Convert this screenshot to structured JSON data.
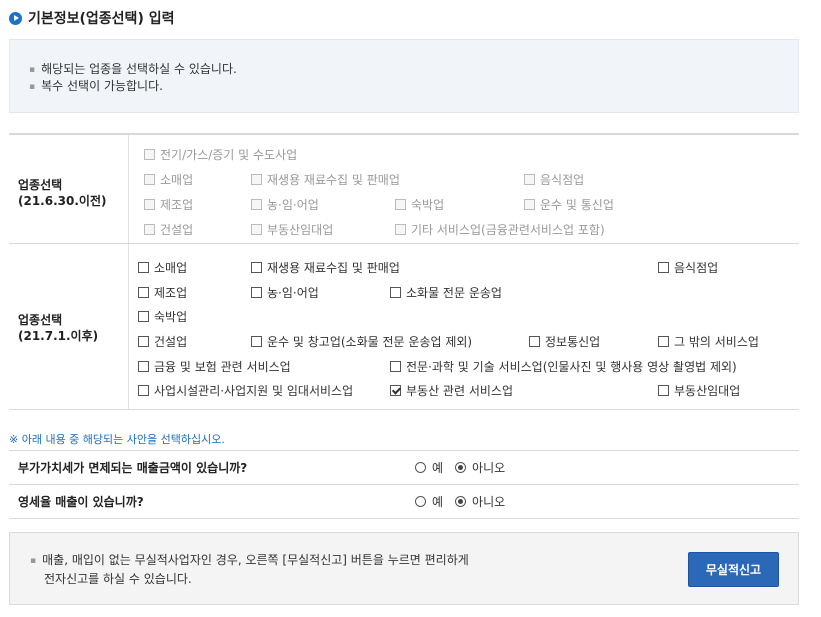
{
  "header": {
    "title": "기본정보(업종선택) 입력"
  },
  "notice": {
    "lines": [
      "해당되는 업종을 선택하실 수 있습니다.",
      "복수 선택이 가능합니다."
    ]
  },
  "old_section": {
    "label_line1": "업종선택",
    "label_line2": "(21.6.30.이전)",
    "items": [
      "전기/가스/증기 및 수도사업",
      "소매업",
      "재생용 재료수집 및 판매업",
      "음식점업",
      "제조업",
      "농·임·어업",
      "숙박업",
      "운수 및 통신업",
      "건설업",
      "부동산임대업",
      "기타 서비스업(금융관련서비스업 포함)"
    ]
  },
  "new_section": {
    "label_line1": "업종선택",
    "label_line2": "(21.7.1.이후)",
    "items": [
      {
        "label": "소매업",
        "checked": false
      },
      {
        "label": "재생용 재료수집 및 판매업",
        "checked": false
      },
      {
        "label": "음식점업",
        "checked": false
      },
      {
        "label": "제조업",
        "checked": false
      },
      {
        "label": "농·임·어업",
        "checked": false
      },
      {
        "label": "소화물 전문 운송업",
        "checked": false
      },
      {
        "label": "숙박업",
        "checked": false
      },
      {
        "label": "건설업",
        "checked": false
      },
      {
        "label": "운수 및 창고업(소화물 전문 운송업 제외)",
        "checked": false
      },
      {
        "label": "정보통신업",
        "checked": false
      },
      {
        "label": "그 밖의 서비스업",
        "checked": false
      },
      {
        "label": "금융 및 보험 관련 서비스업",
        "checked": false
      },
      {
        "label": "전문·과학 및 기술 서비스업(인물사진 및 행사용 영상 촬영법 제외)",
        "checked": false
      },
      {
        "label": "사업시설관리·사업지원 및 임대서비스업",
        "checked": false
      },
      {
        "label": "부동산 관련 서비스업",
        "checked": true
      },
      {
        "label": "부동산임대업",
        "checked": false
      }
    ]
  },
  "guide_note": "※ 아래 내용 중 해당되는 사안을 선택하십시오.",
  "questions": [
    {
      "text": "부가가치세가 면제되는 매출금액이 있습니까?",
      "yes": "예",
      "no": "아니오",
      "selected": "no"
    },
    {
      "text": "영세율 매출이 있습니까?",
      "yes": "예",
      "no": "아니오",
      "selected": "no"
    }
  ],
  "bottom": {
    "line1": "매출, 매입이 없는 무실적사업자인 경우, 오른쪽 [무실적신고] 버튼을 누르면 편리하게",
    "line2": "전자신고를 하실 수 있습니다.",
    "button": "무실적신고"
  },
  "colors": {
    "accent": "#2c68b8",
    "notice_bg": "#f1f5f9",
    "note_text": "#1a6ec0"
  }
}
